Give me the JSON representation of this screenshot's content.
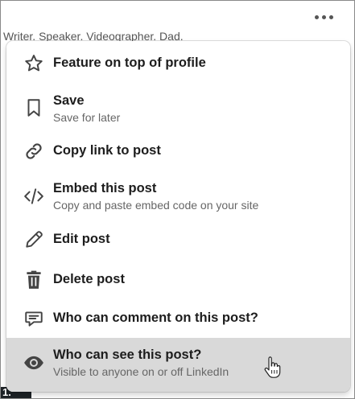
{
  "header": {
    "tagline": "Writer. Speaker. Videographer. Dad.",
    "left_stub_text": "1."
  },
  "menu": {
    "items": [
      {
        "label": "Feature on top of profile",
        "icon": "star-icon"
      },
      {
        "label": "Save",
        "sub": "Save for later",
        "icon": "bookmark-icon"
      },
      {
        "label": "Copy link to post",
        "icon": "link-icon"
      },
      {
        "label": "Embed this post",
        "sub": "Copy and paste embed code on your site",
        "icon": "code-icon"
      },
      {
        "label": "Edit post",
        "icon": "pencil-icon"
      },
      {
        "label": "Delete post",
        "icon": "trash-icon"
      },
      {
        "label": "Who can comment on this post?",
        "icon": "comment-icon"
      },
      {
        "label": "Who can see this post?",
        "sub": "Visible to anyone on or off LinkedIn",
        "icon": "eye-icon",
        "highlighted": true
      }
    ]
  },
  "colors": {
    "highlight": "#d9d9d9",
    "text": "#1d1d1d",
    "subtext": "#666666",
    "icon": "#444444"
  }
}
